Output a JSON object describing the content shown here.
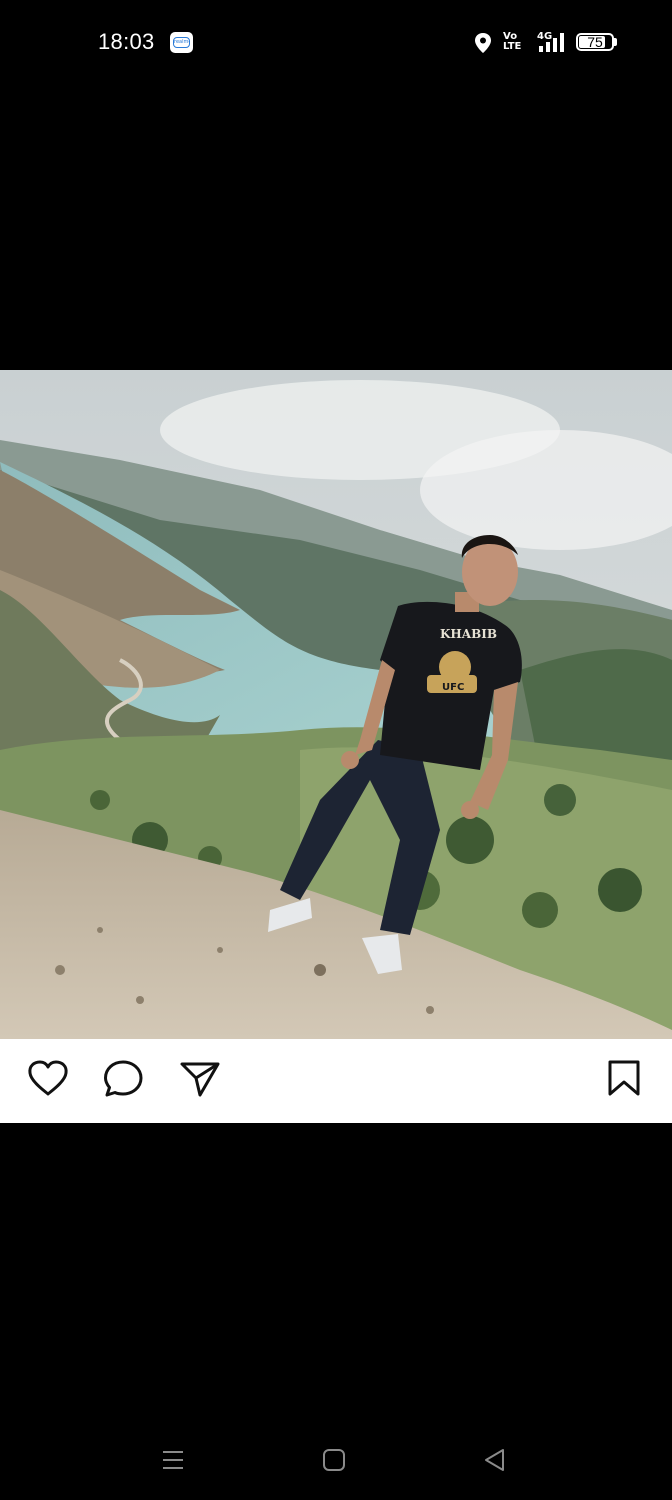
{
  "status_bar": {
    "time": "18:03",
    "app_badge_text": "realme",
    "network_type": "4G",
    "volte_label_top": "Vo",
    "volte_label_bottom": "LTE",
    "battery_level": "75",
    "battery_fraction": 0.75
  },
  "post": {
    "image": {
      "description_icon": "photo-man-on-mountain-overlooking-lake",
      "shirt_text": "KHABIB",
      "shirt_subtext": "UFC"
    },
    "actions": {
      "like_icon": "heart-outline-icon",
      "comment_icon": "speech-bubble-icon",
      "share_icon": "paper-plane-icon",
      "save_icon": "bookmark-icon"
    }
  },
  "navigation_bar": {
    "menu_icon": "menu-icon",
    "home_icon": "home-square-icon",
    "back_icon": "back-triangle-icon"
  },
  "colors": {
    "background": "#000000",
    "action_bar": "#ffffff",
    "icon_dark": "#111111",
    "nav_icons": "#8a8a8a"
  }
}
